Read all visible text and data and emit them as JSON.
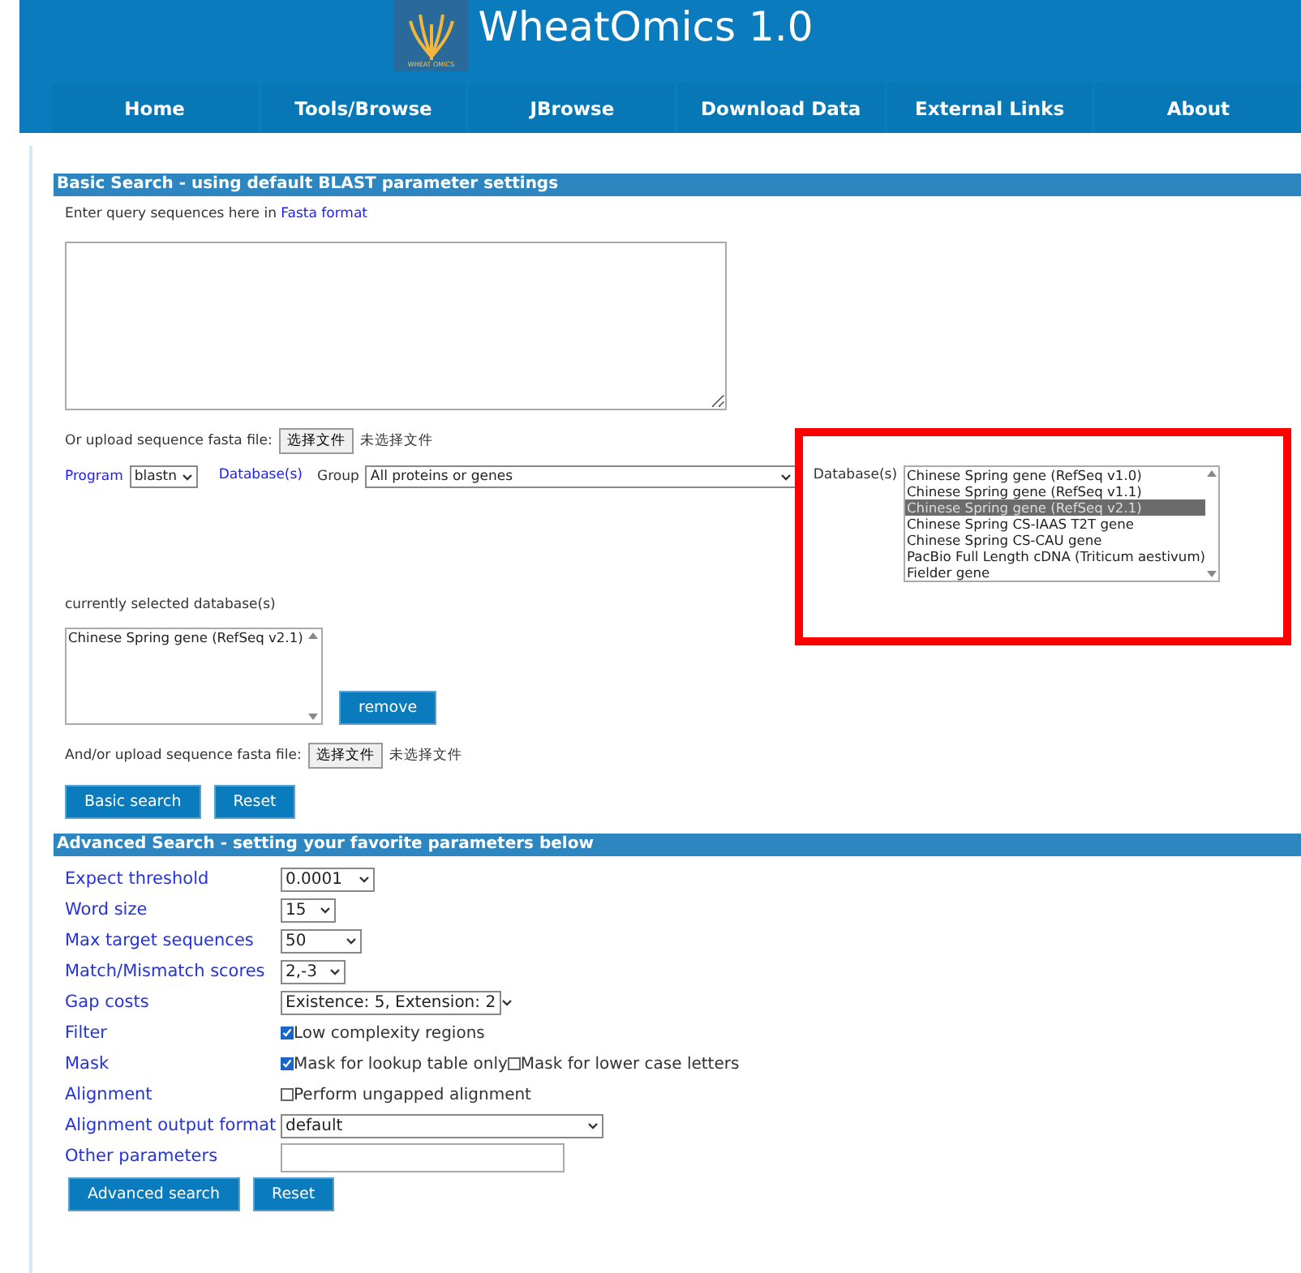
{
  "header": {
    "title": "WheatOmics 1.0",
    "logo_text": "WHEAT OMICS"
  },
  "nav": [
    {
      "label": "Home"
    },
    {
      "label": "Tools/Browse"
    },
    {
      "label": "JBrowse"
    },
    {
      "label": "Download Data"
    },
    {
      "label": "External Links"
    },
    {
      "label": "About"
    }
  ],
  "basic": {
    "heading": "Basic Search - using default BLAST parameter settings",
    "query_prompt": "Enter query sequences here in ",
    "query_link": "Fasta format",
    "upload1": {
      "label": "Or upload sequence fasta file:",
      "button": "选择文件",
      "status": "未选择文件"
    },
    "program": {
      "label": "Program",
      "value": "blastn"
    },
    "databases_link": "Database(s)",
    "group": {
      "label": "Group",
      "value": "All proteins or genes"
    },
    "database_list": {
      "label": "Database(s)",
      "items": [
        {
          "label": "Chinese Spring gene (RefSeq v1.0)",
          "selected": false
        },
        {
          "label": "Chinese Spring gene (RefSeq v1.1)",
          "selected": false
        },
        {
          "label": "Chinese Spring gene (RefSeq v2.1)",
          "selected": true
        },
        {
          "label": "Chinese Spring CS-IAAS T2T gene",
          "selected": false
        },
        {
          "label": "Chinese Spring CS-CAU gene",
          "selected": false
        },
        {
          "label": "PacBio Full Length cDNA (Triticum aestivum)",
          "selected": false
        },
        {
          "label": "Fielder gene",
          "selected": false
        }
      ]
    },
    "selected_heading": "currently selected database(s)",
    "selected_items": [
      "Chinese Spring gene (RefSeq v2.1)"
    ],
    "remove_button": "remove",
    "upload2": {
      "label": "And/or upload sequence fasta file:",
      "button": "选择文件",
      "status": "未选择文件"
    },
    "buttons": [
      "Basic search",
      "Reset"
    ]
  },
  "advanced": {
    "heading": "Advanced Search - setting your favorite parameters below",
    "params": [
      {
        "label": "Expect threshold",
        "kind": "select",
        "value": "0.0001"
      },
      {
        "label": "Word size",
        "kind": "select",
        "value": "15"
      },
      {
        "label": "Max target sequences",
        "kind": "select",
        "value": "50"
      },
      {
        "label": "Match/Mismatch scores",
        "kind": "select",
        "value": "2,-3"
      },
      {
        "label": "Gap costs",
        "kind": "select",
        "value": "Existence: 5, Extension: 2"
      },
      {
        "label": "Filter",
        "kind": "checks",
        "options": [
          {
            "label": "Low complexity regions",
            "checked": true
          }
        ]
      },
      {
        "label": "Mask",
        "kind": "checks",
        "options": [
          {
            "label": "Mask for lookup table only",
            "checked": true
          },
          {
            "label": "Mask for lower case letters",
            "checked": false
          }
        ]
      },
      {
        "label": "Alignment",
        "kind": "checks",
        "options": [
          {
            "label": "Perform ungapped alignment",
            "checked": false
          }
        ]
      },
      {
        "label": "Alignment output format",
        "kind": "select",
        "value": "default"
      },
      {
        "label": "Other parameters",
        "kind": "text"
      }
    ],
    "buttons": [
      "Advanced search",
      "Reset"
    ]
  }
}
